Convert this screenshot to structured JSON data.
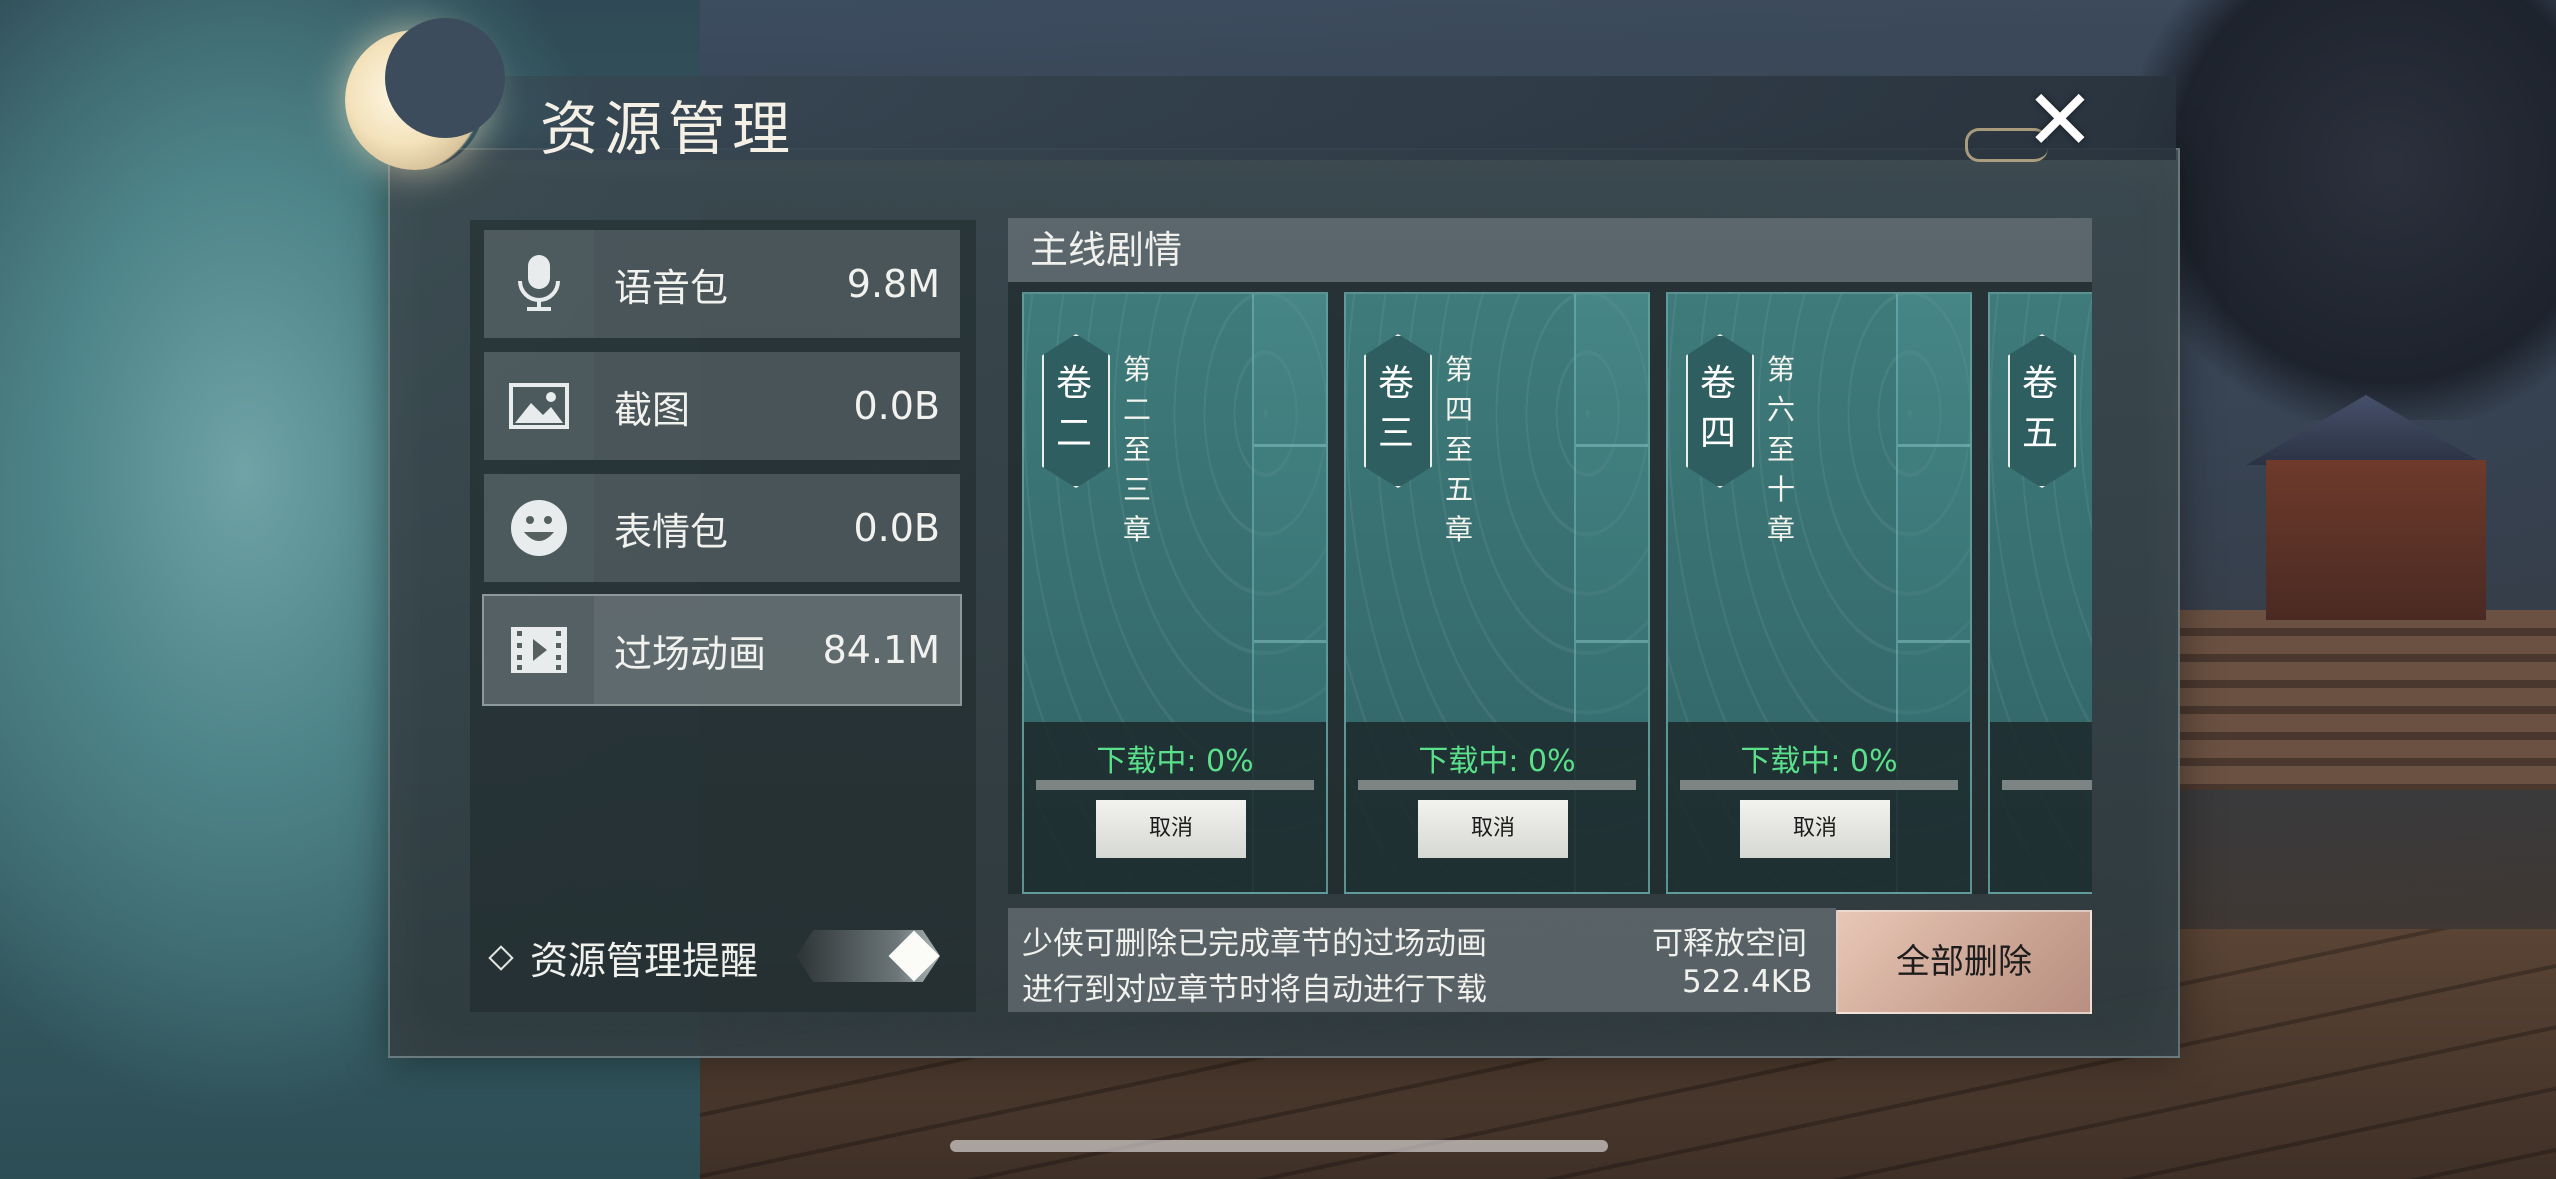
{
  "window": {
    "title": "资源管理"
  },
  "resources": [
    {
      "label": "语音包",
      "size": "9.8M",
      "icon": "microphone-icon"
    },
    {
      "label": "截图",
      "size": "0.0B",
      "icon": "image-icon"
    },
    {
      "label": "表情包",
      "size": "0.0B",
      "icon": "smiley-icon"
    },
    {
      "label": "过场动画",
      "size": "84.1M",
      "icon": "film-icon"
    }
  ],
  "reminder": {
    "label": "资源管理提醒"
  },
  "section": {
    "title": "主线剧情"
  },
  "cards": [
    {
      "vol_top": "卷",
      "vol_bottom": "二",
      "chapters": "第二至三章",
      "status": "下载中: 0%",
      "progress": 0,
      "cancel_label": "取消"
    },
    {
      "vol_top": "卷",
      "vol_bottom": "三",
      "chapters": "第四至五章",
      "status": "下载中: 0%",
      "progress": 0,
      "cancel_label": "取消"
    },
    {
      "vol_top": "卷",
      "vol_bottom": "四",
      "chapters": "第六至十章",
      "status": "下载中: 0%",
      "progress": 0,
      "cancel_label": "取消"
    },
    {
      "vol_top": "卷",
      "vol_bottom": "五"
    }
  ],
  "info": {
    "line1": "少侠可删除已完成章节的过场动画",
    "line2": "进行到对应章节时将自动进行下载",
    "free_label": "可释放空间",
    "free_value": "522.4KB"
  },
  "actions": {
    "delete_all_label": "全部删除"
  },
  "colors": {
    "progress_text": "#5ae08a",
    "card_teal": "#3f7b7b",
    "delete_button": "#e9c7b6"
  }
}
